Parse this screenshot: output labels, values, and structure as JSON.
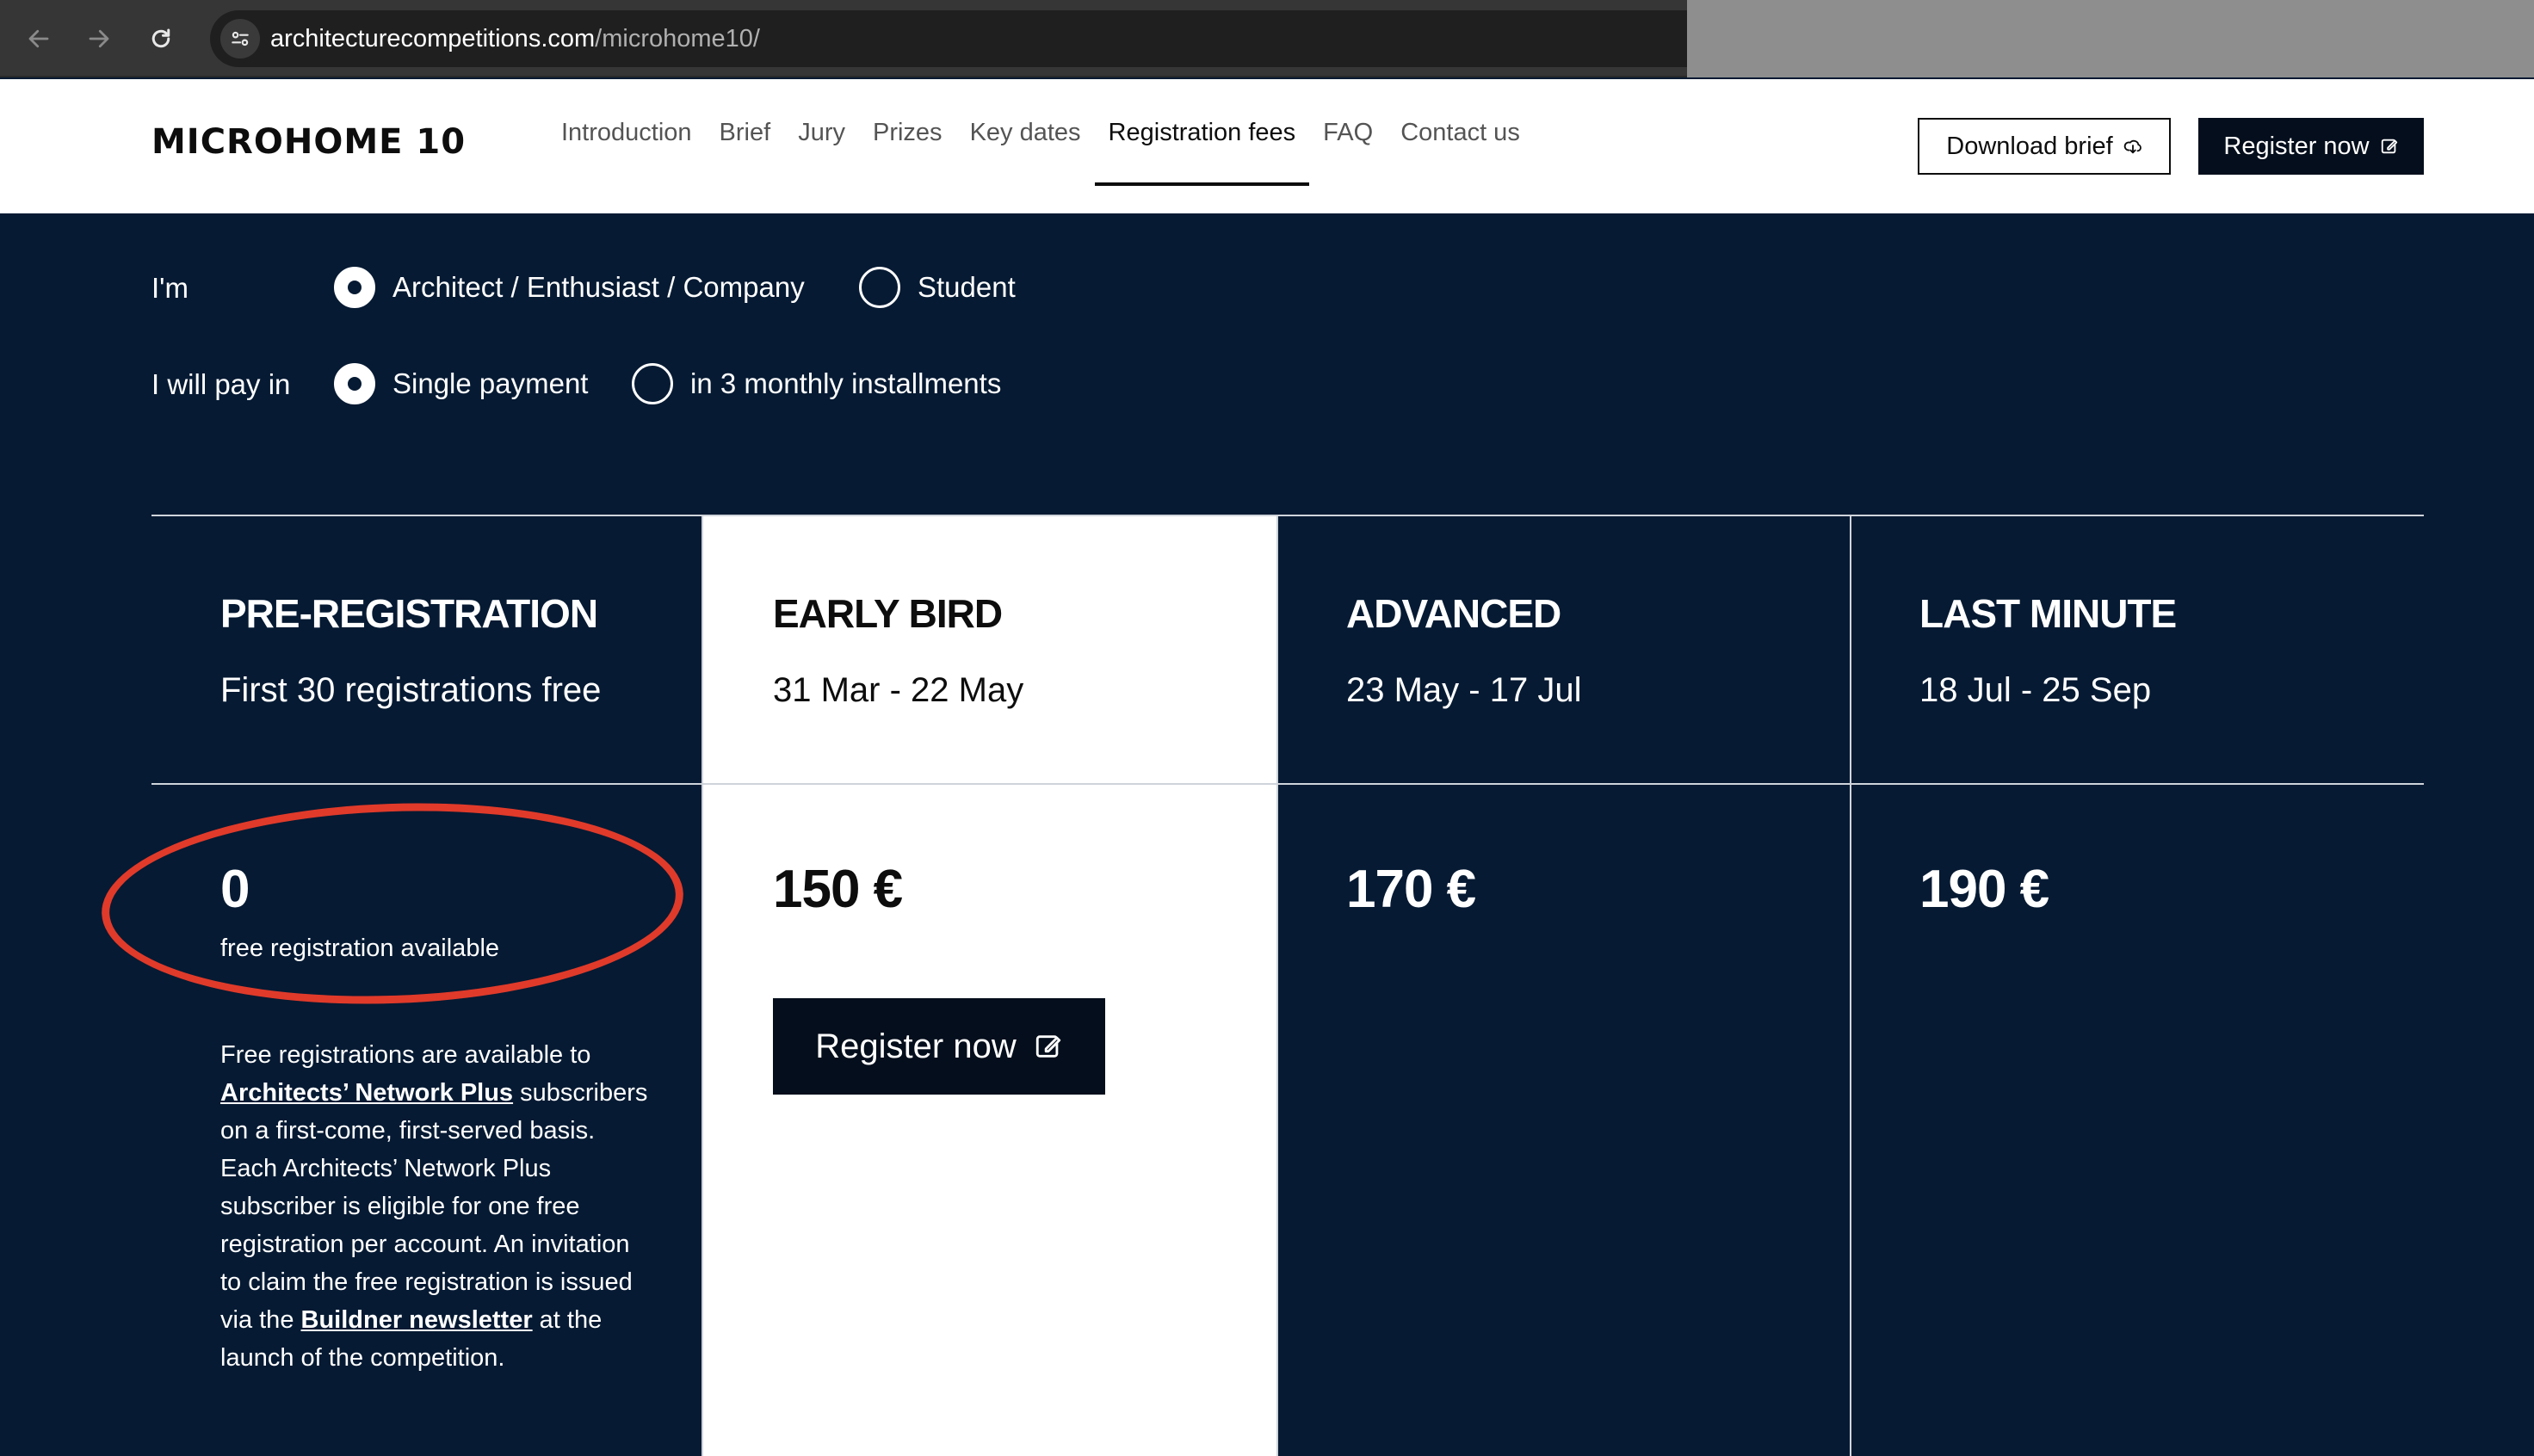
{
  "browser": {
    "url_domain": "architecturecompetitions.com",
    "url_path": "/microhome10/"
  },
  "header": {
    "logo": "MICROHOME 10",
    "nav": [
      "Introduction",
      "Brief",
      "Jury",
      "Prizes",
      "Key dates",
      "Registration fees",
      "FAQ",
      "Contact us"
    ],
    "active_nav": "Registration fees",
    "download_label": "Download brief",
    "register_label": "Register now"
  },
  "options": {
    "role_label": "I'm",
    "roles": [
      {
        "label": "Architect / Enthusiast / Company",
        "selected": true
      },
      {
        "label": "Student",
        "selected": false
      }
    ],
    "pay_label": "I will pay in",
    "payments": [
      {
        "label": "Single payment",
        "selected": true
      },
      {
        "label": "in 3 monthly installments",
        "selected": false
      }
    ]
  },
  "tiers": [
    {
      "title": "PRE-REGISTRATION",
      "subtitle": "First 30 registrations free",
      "price": "0",
      "note": "free registration available"
    },
    {
      "title": "EARLY BIRD",
      "subtitle": "31 Mar - 22 May",
      "price": "150 €",
      "cta": "Register now"
    },
    {
      "title": "ADVANCED",
      "subtitle": "23 May - 17 Jul",
      "price": "170 €"
    },
    {
      "title": "LAST MINUTE",
      "subtitle": "18 Jul - 25 Sep",
      "price": "190 €"
    }
  ],
  "description": {
    "p1": "Free registrations are available to ",
    "link1": "Architects’ Network Plus",
    "p2": " subscribers on a first-come, first-served basis. Each Architects’ Network Plus subscriber is eligible for one free registration per account. An invitation to claim the free registration is issued via the ",
    "link2": "Buildner newsletter",
    "p3": " at the launch of the competition."
  },
  "colors": {
    "background": "#061a33",
    "annotation": "#e03a2a"
  }
}
